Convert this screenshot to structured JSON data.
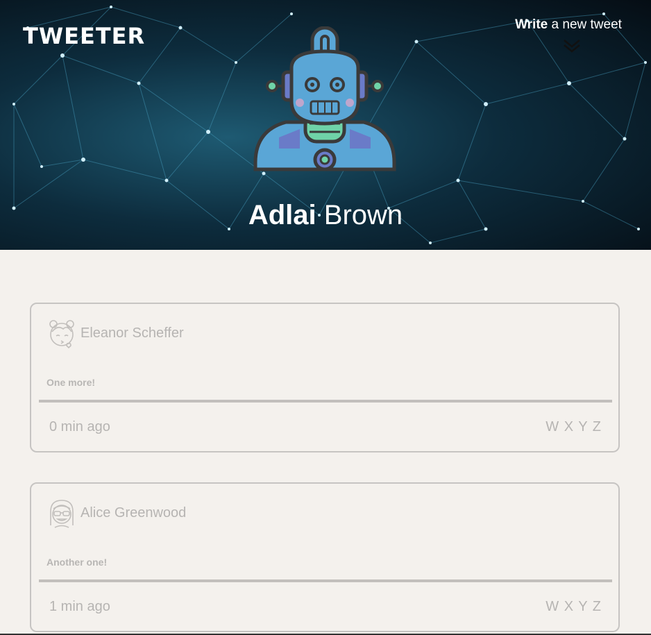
{
  "app": {
    "logo": "TWEETER"
  },
  "nav": {
    "write_bold": "Write",
    "write_rest": " a new tweet",
    "chevron_icon": "double-chevron-down-icon"
  },
  "profile": {
    "first_name": "Adlai",
    "last_name": "Brown",
    "avatar_icon": "robot-avatar-icon"
  },
  "colors": {
    "background": "#f4f1ed",
    "card_border": "#c6c4c2",
    "muted_text": "#b6b4b2",
    "header_dark": "#050d14",
    "network_accent": "#5fc0e0"
  },
  "tweets": [
    {
      "author": "Eleanor Scheffer",
      "avatar_icon": "girl-avatar-icon",
      "text": "One more!",
      "time": "0 min ago",
      "actions": "W X Y Z"
    },
    {
      "author": "Alice Greenwood",
      "avatar_icon": "sunglasses-avatar-icon",
      "text": "Another one!",
      "time": "1 min ago",
      "actions": "W X Y Z"
    }
  ]
}
